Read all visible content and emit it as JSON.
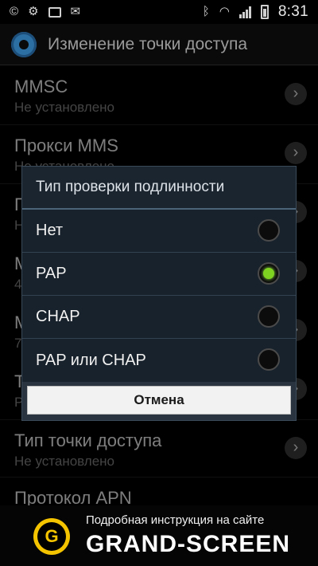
{
  "status_bar": {
    "time": "8:31",
    "icons_left": [
      "copyright-icon",
      "gear-small-icon",
      "image-icon",
      "mail-icon"
    ],
    "icons_right": [
      "bluetooth-icon",
      "wifi-icon",
      "signal-icon",
      "battery-icon"
    ]
  },
  "title_bar": {
    "title": "Изменение точки доступа",
    "icon": "settings-gear-icon"
  },
  "settings_list": [
    {
      "label": "MMSC",
      "value": "Не установлено"
    },
    {
      "label": "Прокси MMS",
      "value": "Не установлено"
    },
    {
      "label": "П",
      "value": "Н"
    },
    {
      "label": "М",
      "value": "4"
    },
    {
      "label": "М",
      "value": "7"
    },
    {
      "label": "Т",
      "value": "Р"
    },
    {
      "label": "Тип точки доступа",
      "value": "Не установлено"
    },
    {
      "label": "Протокол APN",
      "value": ""
    }
  ],
  "dialog": {
    "title": "Тип проверки подлинности",
    "options": [
      {
        "label": "Нет",
        "selected": false
      },
      {
        "label": "PAP",
        "selected": true
      },
      {
        "label": "CHAP",
        "selected": false
      },
      {
        "label": "PAP или CHAP",
        "selected": false
      }
    ],
    "cancel_label": "Отмена"
  },
  "watermark": {
    "logo_letter": "G",
    "text_line1": "Подробная инструкция на сайте",
    "text_line2": "GRAND-SCREEN"
  },
  "colors": {
    "radio_selected": "#7ed321",
    "dialog_bg": "#18222c",
    "badge_yellow": "#f5c400"
  }
}
